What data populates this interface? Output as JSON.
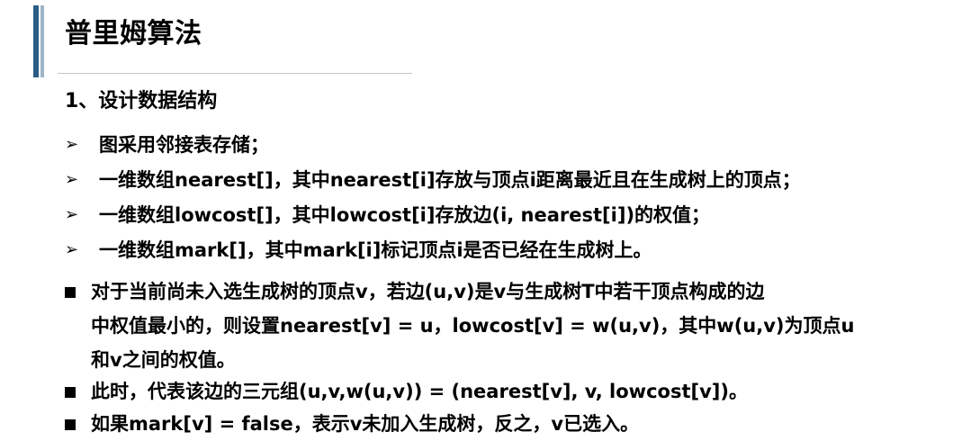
{
  "slide": {
    "title": "普里姆算法",
    "heading": "1、设计数据结构",
    "arrow_items": [
      {
        "marker": "➢",
        "text": "图采用邻接表存储；"
      },
      {
        "marker": "➢",
        "text": "一维数组nearest[]，其中nearest[i]存放与顶点i距离最近且在生成树上的顶点；"
      },
      {
        "marker": "➢",
        "text": "一维数组lowcost[]，其中lowcost[i]存放边(i, nearest[i])的权值；"
      },
      {
        "marker": "➢",
        "text": "一维数组mark[]，其中mark[i]标记顶点i是否已经在生成树上。"
      }
    ],
    "square_items": [
      {
        "lines": [
          "对于当前尚未入选生成树的顶点v，若边(u,v)是v与生成树T中若干顶点构成的边",
          "中权值最小的，则设置nearest[v] = u，lowcost[v] = w(u,v)，其中w(u,v)为顶点u",
          "和v之间的权值。"
        ]
      },
      {
        "lines": [
          "此时，代表该边的三元组(u,v,w(u,v)) = (nearest[v], v, lowcost[v])。"
        ]
      },
      {
        "lines": [
          "如果mark[v] = false，表示v未加入生成树，反之，v已选入。"
        ]
      }
    ]
  },
  "colors": {
    "accent_bar_dark": "#2c5c86",
    "accent_bar_light": "#9fb4c7",
    "divider": "#c8c8c8",
    "text": "#000000"
  }
}
